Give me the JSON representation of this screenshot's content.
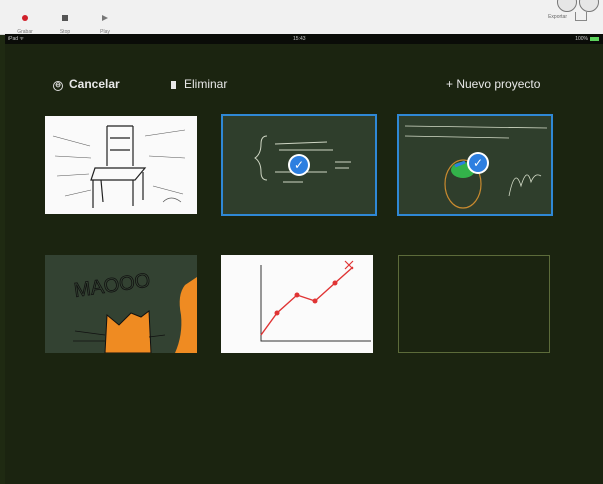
{
  "toolbar": {
    "record_label": "Grabar",
    "stop_label": "Stop",
    "play_label": "Play",
    "export_label": "Exportar"
  },
  "status": {
    "left": "iPad ᯤ",
    "time": "15:43",
    "battery": "100%"
  },
  "actions": {
    "cancel": "Cancelar",
    "delete": "Eliminar",
    "new_project": "+ Nuevo proyecto"
  },
  "projects": [
    {
      "name": "chair-sketch",
      "selected": false
    },
    {
      "name": "math-formulas",
      "selected": true
    },
    {
      "name": "handwritten-notes",
      "selected": true
    },
    {
      "name": "cat-drawing",
      "selected": false,
      "text": "MAOOO"
    },
    {
      "name": "line-graph",
      "selected": false
    },
    {
      "name": "empty-project",
      "selected": false
    }
  ],
  "colors": {
    "background": "#1f2a12",
    "accent": "#2f88d6",
    "record": "#d0202a"
  }
}
